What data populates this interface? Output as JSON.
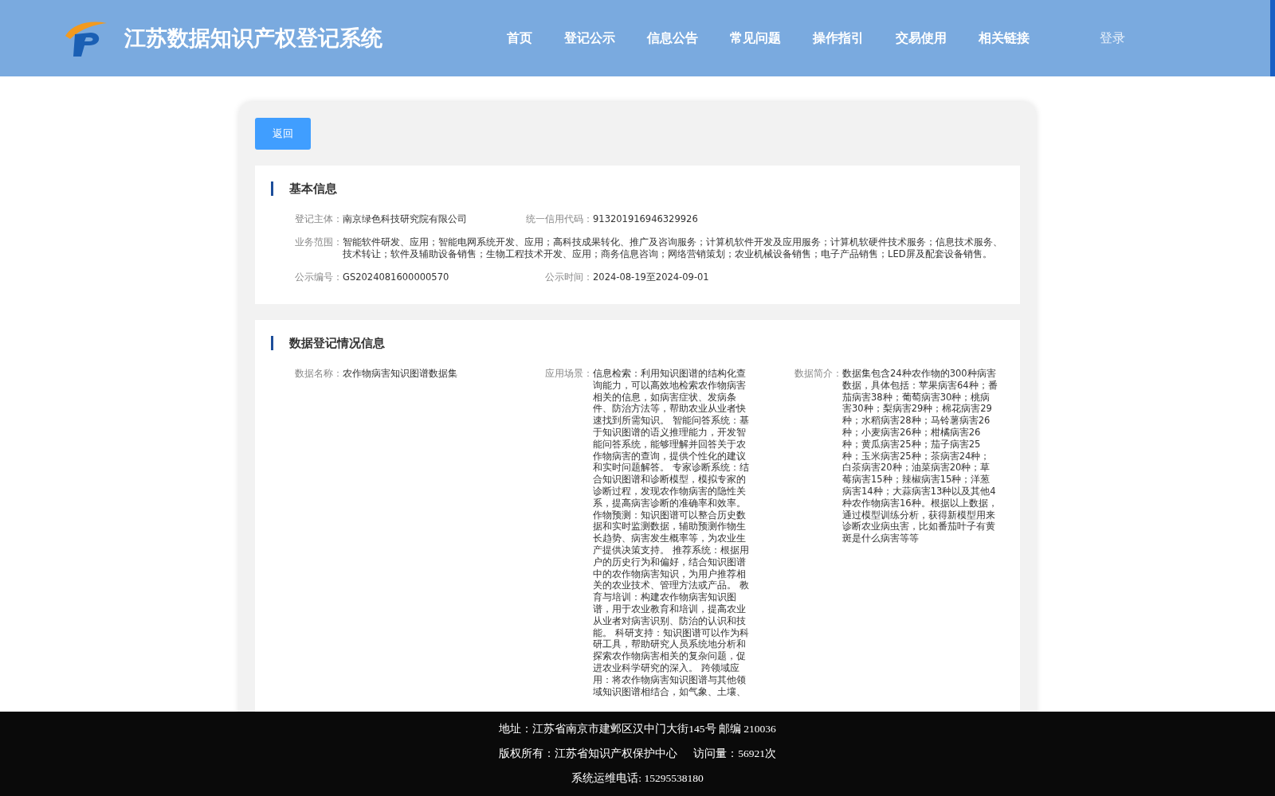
{
  "header": {
    "title": "江苏数据知识产权登记系统",
    "nav": [
      {
        "label": "首页"
      },
      {
        "label": "登记公示"
      },
      {
        "label": "信息公告"
      },
      {
        "label": "常见问题"
      },
      {
        "label": "操作指引"
      },
      {
        "label": "交易使用"
      },
      {
        "label": "相关链接"
      }
    ],
    "login": "登录"
  },
  "back_button": "返回",
  "basic_info": {
    "title": "基本信息",
    "fields": [
      {
        "label": "登记主体：",
        "value": "南京绿色科技研究院有限公司",
        "kind": "half"
      },
      {
        "label": "统一信用代码：",
        "value": "913201916946329926",
        "kind": "half"
      },
      {
        "label": "业务范围：",
        "value": "智能软件研发、应用；智能电网系统开发、应用；高科技成果转化、推广及咨询服务；计算机软件开发及应用服务；计算机软硬件技术服务；信息技术服务、技术转让；软件及辅助设备销售；生物工程技术开发、应用；商务信息咨询；网络营销策划；农业机械设备销售；电子产品销售；LED屏及配套设备销售。",
        "kind": "full"
      },
      {
        "label": "公示编号：",
        "value": "GS2024081600000570",
        "kind": "half"
      },
      {
        "label": "公示时间：",
        "value": "2024-08-19至2024-09-01",
        "kind": "half"
      }
    ]
  },
  "registration_info": {
    "title": "数据登记情况信息",
    "fields": [
      {
        "label": "数据名称：",
        "value": "农作物病害知识图谱数据集"
      },
      {
        "label": "应用场景：",
        "value": "信息检索：利用知识图谱的结构化查询能力，可以高效地检索农作物病害相关的信息，如病害症状、发病条件、防治方法等，帮助农业从业者快速找到所需知识。 智能问答系统：基于知识图谱的语义推理能力，开发智能问答系统，能够理解并回答关于农作物病害的查询，提供个性化的建议和实时问题解答。 专家诊断系统：结合知识图谱和诊断模型，模拟专家的诊断过程，发现农作物病害的隐性关系，提高病害诊断的准确率和效率。作物预测：知识图谱可以整合历史数据和实时监测数据，辅助预测作物生长趋势、病害发生概率等，为农业生产提供决策支持。 推荐系统：根据用户的历史行为和偏好，结合知识图谱中的农作物病害知识，为用户推荐相关的农业技术、管理方法或产品。 教育与培训：构建农作物病害知识图谱，用于农业教育和培训，提高农业从业者对病害识别、防治的认识和技能。 科研支持：知识图谱可以作为科研工具，帮助研究人员系统地分析和探索农作物病害相关的复杂问题，促进农业科学研究的深入。 跨领域应用：将农作物病害知识图谱与其他领域知识图谱相结合，如气象、土壤、"
      },
      {
        "label": "数据简介：",
        "value": "数据集包含24种农作物的300种病害数据，具体包括：苹果病害64种；番茄病害38种；葡萄病害30种；桃病害30种；梨病害29种；棉花病害29种；水稻病害28种；马铃薯病害26种；小麦病害26种；柑橘病害26种；黄瓜病害25种；茄子病害25种；玉米病害25种；茶病害24种；白茶病害20种；油菜病害20种；草莓病害15种；辣椒病害15种；洋葱病害14种；大蒜病害13种以及其他4种农作物病害16种。根据以上数据，通过模型训练分析，获得新模型用来诊断农业病虫害，比如番茄叶子有黄斑是什么病害等等"
      }
    ]
  },
  "footer": {
    "lines": [
      "地址：江苏省南京市建邺区汉中门大街145号 邮编 210036",
      "版权所有：江苏省知识产权保护中心",
      "访问量：56921次",
      "系统运维电话: 15295538180"
    ]
  }
}
